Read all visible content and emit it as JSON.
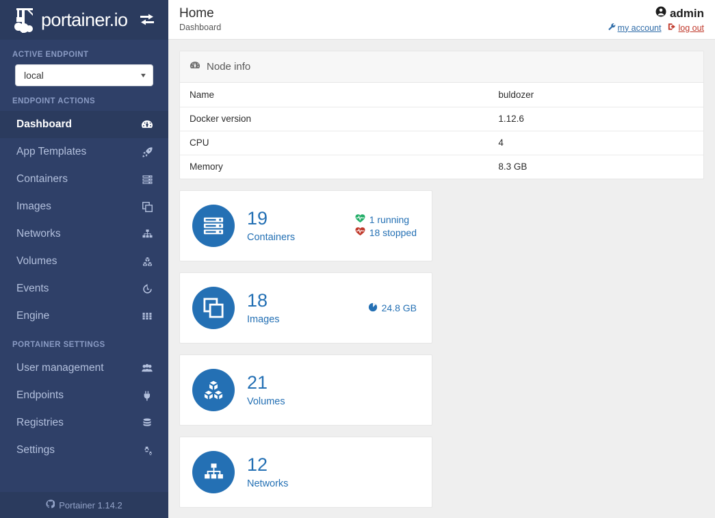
{
  "brand": {
    "name": "portainer.io",
    "logo_icon": "portainer-crane-logo",
    "toggle_icon": "exchange-arrows-icon"
  },
  "sidebar": {
    "sections": [
      {
        "title": "ACTIVE ENDPOINT"
      },
      {
        "title": "ENDPOINT ACTIONS"
      },
      {
        "title": "PORTAINER SETTINGS"
      }
    ],
    "endpoint_select": {
      "value": "local",
      "caret_icon": "chevron-down-icon"
    },
    "endpoint_actions": [
      {
        "label": "Dashboard",
        "icon": "tachometer-icon",
        "active": true
      },
      {
        "label": "App Templates",
        "icon": "rocket-icon",
        "active": false
      },
      {
        "label": "Containers",
        "icon": "server-icon",
        "active": false
      },
      {
        "label": "Images",
        "icon": "clone-icon",
        "active": false
      },
      {
        "label": "Networks",
        "icon": "sitemap-icon",
        "active": false
      },
      {
        "label": "Volumes",
        "icon": "cubes-icon",
        "active": false
      },
      {
        "label": "Events",
        "icon": "history-icon",
        "active": false
      },
      {
        "label": "Engine",
        "icon": "th-grid-icon",
        "active": false
      }
    ],
    "portainer_settings": [
      {
        "label": "User management",
        "icon": "users-icon",
        "active": false
      },
      {
        "label": "Endpoints",
        "icon": "plug-icon",
        "active": false
      },
      {
        "label": "Registries",
        "icon": "database-icon",
        "active": false
      },
      {
        "label": "Settings",
        "icon": "cogs-icon",
        "active": false
      }
    ],
    "footer": {
      "icon": "github-icon",
      "text": "Portainer 1.14.2"
    }
  },
  "header": {
    "title": "Home",
    "subtitle": "Dashboard",
    "user": {
      "name": "admin",
      "icon": "user-circle-icon"
    },
    "links": [
      {
        "label": "my account",
        "icon": "wrench-icon",
        "color": "#2f6ca8"
      },
      {
        "label": "log out",
        "icon": "sign-out-icon",
        "color": "#c0392b"
      }
    ]
  },
  "node_info": {
    "panel_title": "Node info",
    "panel_icon": "tachometer-icon",
    "rows": [
      {
        "key": "Name",
        "value": "buldozer"
      },
      {
        "key": "Docker version",
        "value": "1.12.6"
      },
      {
        "key": "CPU",
        "value": "4"
      },
      {
        "key": "Memory",
        "value": "8.3 GB"
      }
    ]
  },
  "stat_cards": [
    {
      "value": "19",
      "label": "Containers",
      "icon": "server-icon",
      "extra": [
        {
          "text": "1 running",
          "icon": "heartbeat-icon",
          "color": "#23ae68"
        },
        {
          "text": "18 stopped",
          "icon": "heartbeat-icon",
          "color": "#c0392b"
        }
      ]
    },
    {
      "value": "18",
      "label": "Images",
      "icon": "clone-icon",
      "extra": [
        {
          "text": "24.8 GB",
          "icon": "pie-chart-icon",
          "color": "#2470b4"
        }
      ]
    },
    {
      "value": "21",
      "label": "Volumes",
      "icon": "cubes-icon",
      "extra": []
    },
    {
      "value": "12",
      "label": "Networks",
      "icon": "sitemap-icon",
      "extra": []
    }
  ],
  "colors": {
    "sidebar_bg": "#2f4068",
    "sidebar_dark": "#2b3b5e",
    "accent_blue": "#2470b4",
    "content_bg": "#efefef",
    "running_green": "#23ae68",
    "stopped_red": "#c0392b"
  }
}
